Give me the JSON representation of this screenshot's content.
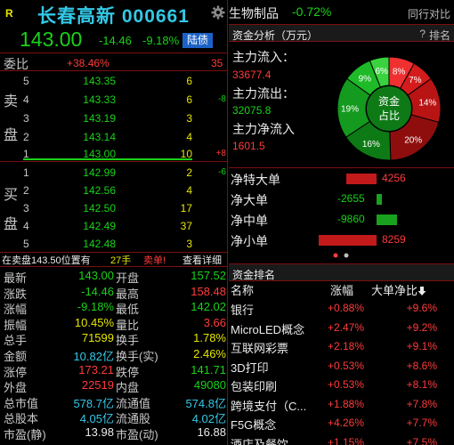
{
  "stock": {
    "badge_r": "R",
    "name_code": "长春高新 000661",
    "price": "143.00",
    "change": "-14.46",
    "change_pct": "-9.18%",
    "board": "陆债"
  },
  "weibi": {
    "label": "委比",
    "pct": "+38.46%",
    "diff": "35"
  },
  "orderbook": {
    "sell_char_1": "卖",
    "sell_char_2": "盘",
    "buy_char_1": "买",
    "buy_char_2": "盘",
    "sells": [
      {
        "level": "5",
        "price": "143.35",
        "vol": "6",
        "chg": ""
      },
      {
        "level": "4",
        "price": "143.33",
        "vol": "6",
        "chg": "-8"
      },
      {
        "level": "3",
        "price": "143.19",
        "vol": "3",
        "chg": ""
      },
      {
        "level": "2",
        "price": "143.14",
        "vol": "4",
        "chg": ""
      },
      {
        "level": "1",
        "price": "143.00",
        "vol": "10",
        "chg": "+8"
      }
    ],
    "buys": [
      {
        "level": "1",
        "price": "142.99",
        "vol": "2",
        "chg": "-6"
      },
      {
        "level": "2",
        "price": "142.56",
        "vol": "4",
        "chg": ""
      },
      {
        "level": "3",
        "price": "142.50",
        "vol": "17",
        "chg": ""
      },
      {
        "level": "4",
        "price": "142.49",
        "vol": "37",
        "chg": ""
      },
      {
        "level": "5",
        "price": "142.48",
        "vol": "3",
        "chg": ""
      }
    ]
  },
  "trade_line": {
    "text": "在卖盘143.50位置有",
    "hands": "27手",
    "action": "卖单!",
    "detail": "查看详细"
  },
  "stats": [
    {
      "k1": "最新",
      "v1": "143.00",
      "c1": "green",
      "k2": "开盘",
      "v2": "157.52",
      "c2": "green"
    },
    {
      "k1": "涨跌",
      "v1": "-14.46",
      "c1": "green",
      "k2": "最高",
      "v2": "158.48",
      "c2": "red"
    },
    {
      "k1": "涨幅",
      "v1": "-9.18%",
      "c1": "green",
      "k2": "最低",
      "v2": "142.02",
      "c2": "green"
    },
    {
      "k1": "振幅",
      "v1": "10.45%",
      "c1": "yellow",
      "k2": "量比",
      "v2": "3.66",
      "c2": "red"
    },
    {
      "k1": "总手",
      "v1": "71599",
      "c1": "yellow",
      "k2": "换手",
      "v2": "1.78%",
      "c2": "yellow"
    },
    {
      "k1": "金额",
      "v1": "10.82亿",
      "c1": "cyan",
      "k2": "换手(实)",
      "v2": "2.46%",
      "c2": "yellow"
    },
    {
      "k1": "涨停",
      "v1": "173.21",
      "c1": "red",
      "k2": "跌停",
      "v2": "141.71",
      "c2": "green"
    },
    {
      "k1": "外盘",
      "v1": "22519",
      "c1": "red",
      "k2": "内盘",
      "v2": "49080",
      "c2": "green"
    },
    {
      "k1": "总市值",
      "v1": "578.7亿",
      "c1": "cyan",
      "k2": "流通值",
      "v2": "574.8亿",
      "c2": "cyan"
    },
    {
      "k1": "总股本",
      "v1": "4.05亿",
      "c1": "cyan",
      "k2": "流通股",
      "v2": "4.02亿",
      "c2": "cyan"
    },
    {
      "k1": "市盈(静)",
      "v1": "13.98",
      "c1": "white",
      "k2": "市盈(动)",
      "v2": "16.88",
      "c2": "white"
    }
  ],
  "sector": {
    "name": "生物制品",
    "pct": "-0.72%",
    "compare": "同行对比"
  },
  "fund": {
    "title": "资金分析（万元）",
    "help": "?",
    "rank": "排名",
    "main_in_label": "主力流入：",
    "main_in_value": "33677.4",
    "main_out_label": "主力流出：",
    "main_out_value": "32075.8",
    "main_net_label": "主力净流入",
    "main_net_value": "1601.5",
    "donut_center_1": "资金",
    "donut_center_2": "占比",
    "donut": [
      {
        "label": "8%",
        "value": 8,
        "color": "#f03030"
      },
      {
        "label": "7%",
        "value": 7,
        "color": "#d41c1c"
      },
      {
        "label": "14%",
        "value": 14,
        "color": "#b81414"
      },
      {
        "label": "20%",
        "value": 20,
        "color": "#8e0e0e"
      },
      {
        "label": "16%",
        "value": 16,
        "color": "#0e7a16"
      },
      {
        "label": "19%",
        "value": 19,
        "color": "#149a1e"
      },
      {
        "label": "9%",
        "value": 9,
        "color": "#1eba28"
      },
      {
        "label": "6%",
        "value": 6,
        "color": "#3ad23e"
      }
    ]
  },
  "net_flows": [
    {
      "label": "净特大单",
      "value": "4256",
      "sign": "pos",
      "mag": 4256
    },
    {
      "label": "净大单",
      "value": "-2655",
      "sign": "neg",
      "mag": 2655
    },
    {
      "label": "净中单",
      "value": "-9860",
      "sign": "neg",
      "mag": 9860
    },
    {
      "label": "净小单",
      "value": "8259",
      "sign": "pos",
      "mag": 8259
    }
  ],
  "ranking": {
    "title": "资金排名",
    "col_name": "名称",
    "col_change": "涨幅",
    "col_netratio": "大单净比",
    "rows": [
      {
        "name": "银行",
        "change": "+0.88%",
        "ratio": "+9.6%"
      },
      {
        "name": "MicroLED概念",
        "change": "+2.47%",
        "ratio": "+9.2%"
      },
      {
        "name": "互联网彩票",
        "change": "+2.18%",
        "ratio": "+9.1%"
      },
      {
        "name": "3D打印",
        "change": "+0.53%",
        "ratio": "+8.6%"
      },
      {
        "name": "包装印刷",
        "change": "+0.53%",
        "ratio": "+8.1%"
      },
      {
        "name": "跨境支付（C...",
        "change": "+1.88%",
        "ratio": "+7.8%"
      },
      {
        "name": "F5G概念",
        "change": "+4.26%",
        "ratio": "+7.7%"
      },
      {
        "name": "酒店及餐饮",
        "change": "+1.15%",
        "ratio": "+7.5%"
      }
    ]
  },
  "colors": {
    "up": "#ff3b3b",
    "down": "#19d219",
    "accent_cyan": "#33c8e6",
    "badge_blue": "#1c62c6",
    "divider": "#7a1010"
  }
}
